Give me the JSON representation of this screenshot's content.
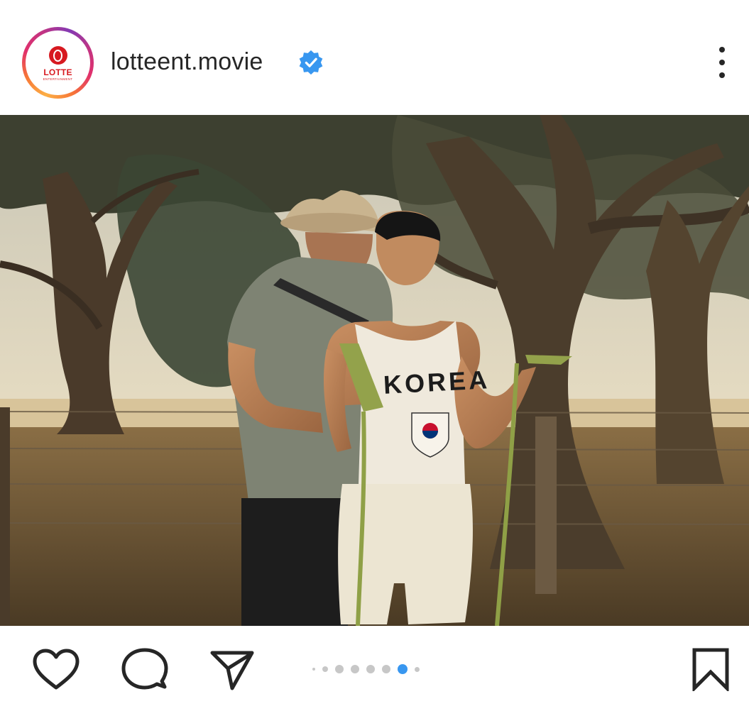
{
  "post": {
    "username": "lotteent.movie",
    "verified": true,
    "avatar": {
      "brand": "LOTTE",
      "tagline": "ENTERTAINMENT"
    }
  },
  "photo": {
    "jersey_text": "KOREA",
    "scene": "outdoor training under trees"
  },
  "carousel": {
    "total_dots": 8,
    "active_index": 6
  },
  "icons": {
    "like": "heart-icon",
    "comment": "comment-icon",
    "share": "send-icon",
    "save": "bookmark-icon",
    "more": "more-vertical-icon",
    "verified": "verified-badge-icon"
  },
  "colors": {
    "accent": "#3897f0",
    "text": "#262626",
    "brand": "#d71920"
  }
}
